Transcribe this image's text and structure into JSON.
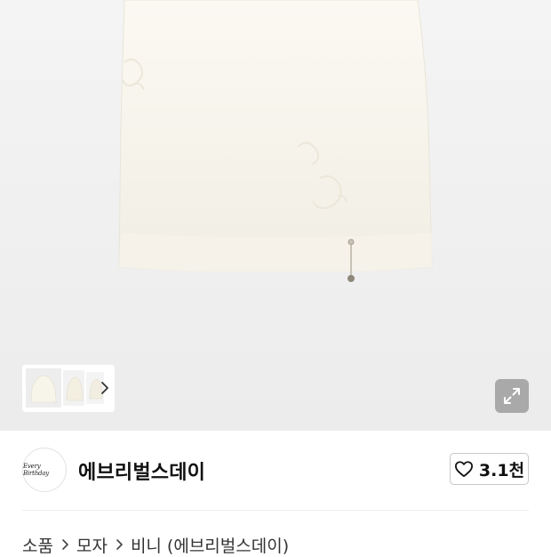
{
  "hero": {
    "image_icon": "knit-beanie-product-image",
    "thumbnail_icon": "product-thumbnails",
    "thumbnail_arrow_icon": "chevron-right-icon",
    "expand_icon": "expand-arrows-icon"
  },
  "brand": {
    "logo_text": "Every Birthday",
    "name": "에브리벌스데이"
  },
  "like": {
    "icon": "heart-outline-icon",
    "count": "3.1천"
  },
  "breadcrumb": {
    "items": [
      "소품",
      "모자",
      "비니 (에브리벌스데이)"
    ],
    "separator_icon": "chevron-right-icon"
  }
}
